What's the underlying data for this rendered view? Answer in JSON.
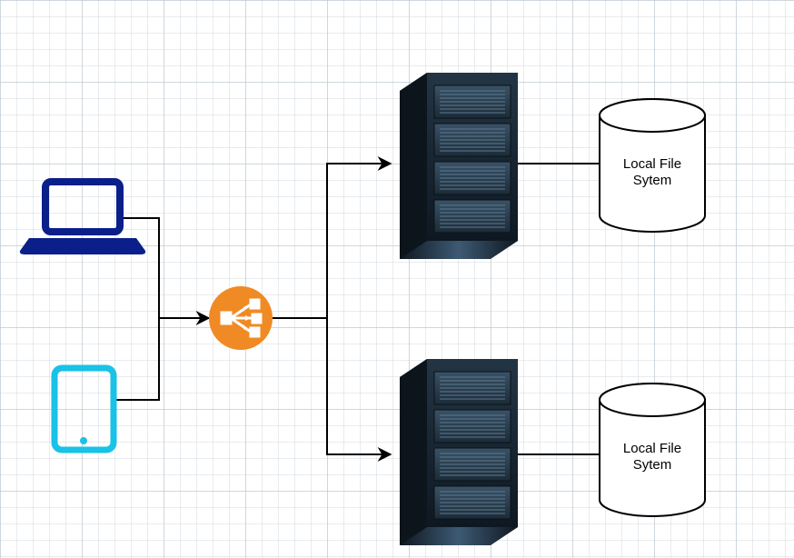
{
  "icons": {
    "laptop_name": "laptop-icon",
    "tablet_name": "tablet-icon",
    "loadbalancer_name": "load-balancer-icon",
    "server_top_name": "server-top-icon",
    "server_bottom_name": "server-bottom-icon"
  },
  "cylinders": {
    "top": {
      "name": "database-top",
      "line1": "Local File",
      "line2": "Sytem"
    },
    "bottom": {
      "name": "database-bottom",
      "line1": "Local File",
      "line2": "Sytem"
    }
  },
  "colors": {
    "laptop": "#0b1f8a",
    "tablet": "#19c2e6",
    "lb_fill": "#f08a24",
    "lb_inner": "#ffffff",
    "server_dark": "#1a2733",
    "server_mid": "#2f4354",
    "server_light": "#3d5a73",
    "cylinder_stroke": "#000000"
  }
}
